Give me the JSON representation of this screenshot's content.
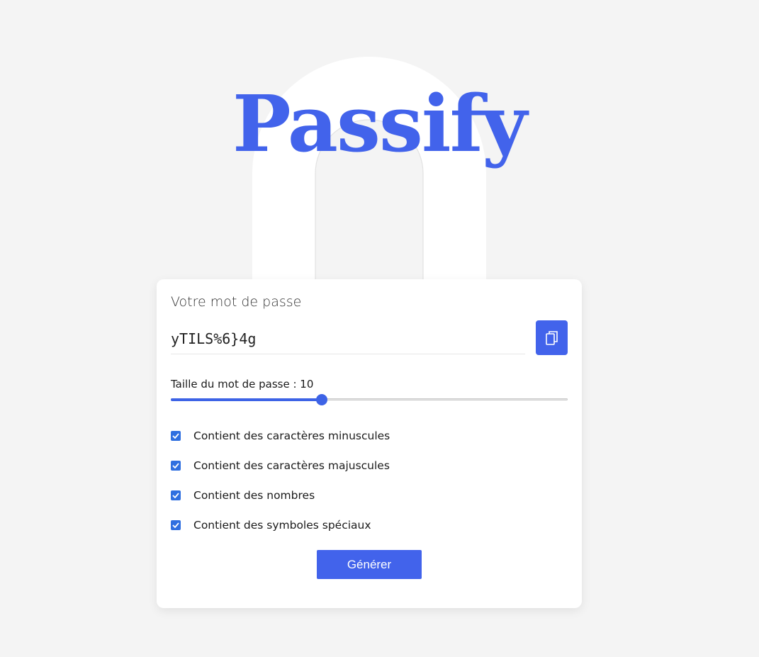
{
  "app": {
    "logo_text": "Passify",
    "accent_color": "#4263eb"
  },
  "card": {
    "title": "Votre mot de passe",
    "password_value": "yTILS%6}4g",
    "copy_icon": "copy-icon",
    "length_label": "Taille du mot de passe : 10",
    "length_value": 10,
    "length_fraction": 0.38,
    "options": [
      {
        "label": "Contient des caractères minuscules",
        "checked": true
      },
      {
        "label": "Contient des caractères majuscules",
        "checked": true
      },
      {
        "label": "Contient des nombres",
        "checked": true
      },
      {
        "label": "Contient des symboles spéciaux",
        "checked": true
      }
    ],
    "generate_label": "Générer"
  }
}
